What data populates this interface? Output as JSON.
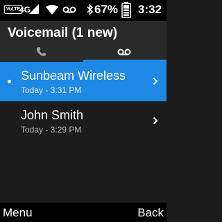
{
  "status_bar": {
    "volte_label": "VoLTE",
    "network": "4G",
    "battery_percent": "67%",
    "time": "3:32",
    "icons": [
      "volte-icon",
      "signal-icon",
      "wifi-icon",
      "voicemail-icon",
      "bluetooth-icon",
      "battery-icon"
    ]
  },
  "header": {
    "title": "Voicemail (1 new)"
  },
  "tabs": [
    {
      "icon": "phone-icon",
      "selected": false
    },
    {
      "icon": "voicemail-icon",
      "selected": true
    }
  ],
  "voicemails": [
    {
      "name": "Sunbeam Wireless",
      "time": "Today - 3:31 PM",
      "unread": true,
      "selected": true
    },
    {
      "name": "John Smith",
      "time": "Today - 3:29 PM",
      "unread": false,
      "selected": false
    }
  ],
  "softkeys": {
    "left": "Menu",
    "right": "Back"
  },
  "colors": {
    "accent": "#1e88e5",
    "background": "#1c1c1c",
    "status_bar": "#000000"
  }
}
